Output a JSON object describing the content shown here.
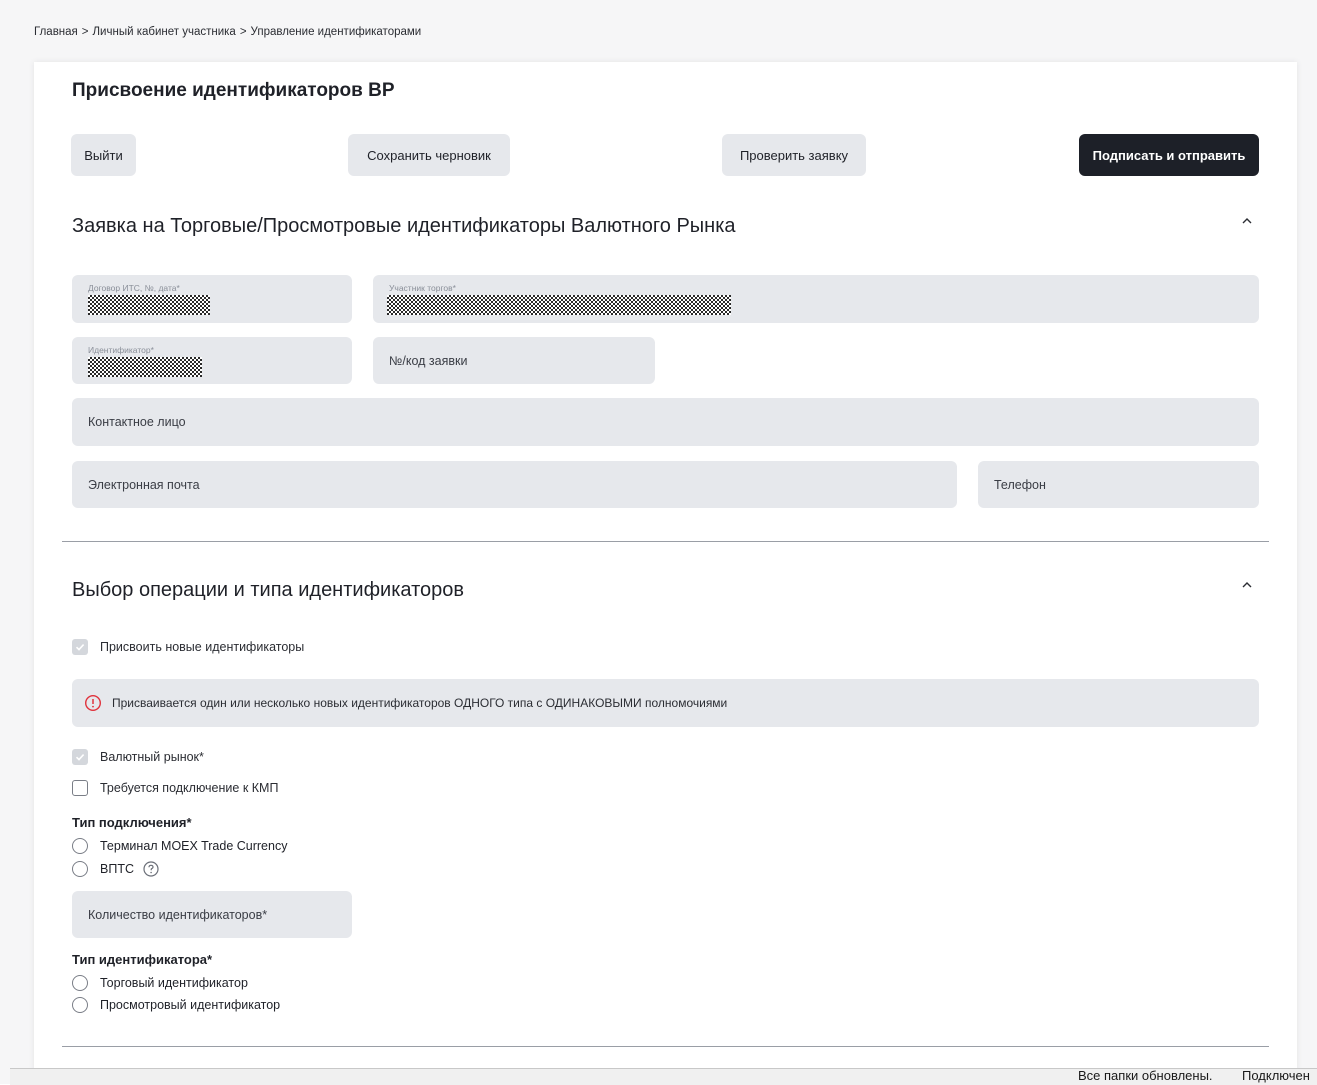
{
  "breadcrumb": {
    "items": [
      "Главная",
      "Личный кабинет участника",
      "Управление идентификаторами"
    ],
    "separator": ">"
  },
  "page": {
    "title": "Присвоение идентификаторов ВР"
  },
  "actions": {
    "exit": "Выйти",
    "save_draft": "Сохранить черновик",
    "check": "Проверить заявку",
    "sign_send": "Подписать и отправить"
  },
  "section1": {
    "title": "Заявка на Торговые/Просмотровые идентификаторы Валютного Рынка",
    "fields": {
      "contract": {
        "label": "Договор ИТС, №, дата*"
      },
      "participant": {
        "label": "Участник торгов*"
      },
      "identifier": {
        "label": "Идентификатор*"
      },
      "request_no": {
        "placeholder": "№/код заявки"
      },
      "contact": {
        "placeholder": "Контактное лицо"
      },
      "email": {
        "placeholder": "Электронная почта"
      },
      "phone": {
        "placeholder": "Телефон"
      }
    }
  },
  "section2": {
    "title": "Выбор операции и типа идентификаторов",
    "assign_new": {
      "label": "Присвоить новые идентификаторы",
      "checked": true
    },
    "info": "Присваивается один или несколько новых идентификаторов ОДНОГО типа с ОДИНАКОВЫМИ полномочиями",
    "currency_market": {
      "label": "Валютный рынок*",
      "checked": true
    },
    "kmp": {
      "label": "Требуется подключение к КМП",
      "checked": false
    },
    "connection_type": {
      "label": "Тип подключения*",
      "options": [
        "Терминал MOEX Trade Currency",
        "ВПТС"
      ]
    },
    "count_field": {
      "placeholder": "Количество идентификаторов*"
    },
    "identifier_type": {
      "label": "Тип идентификатора*",
      "options": [
        "Торговый идентификатор",
        "Просмотровый идентификатор"
      ]
    }
  },
  "status_bar": {
    "left": "Все папки обновлены.",
    "right": "Подключен"
  },
  "colors": {
    "primary_button": "#1d2028",
    "field_bg": "#e6e8ec",
    "info_icon": "#e0323c"
  }
}
